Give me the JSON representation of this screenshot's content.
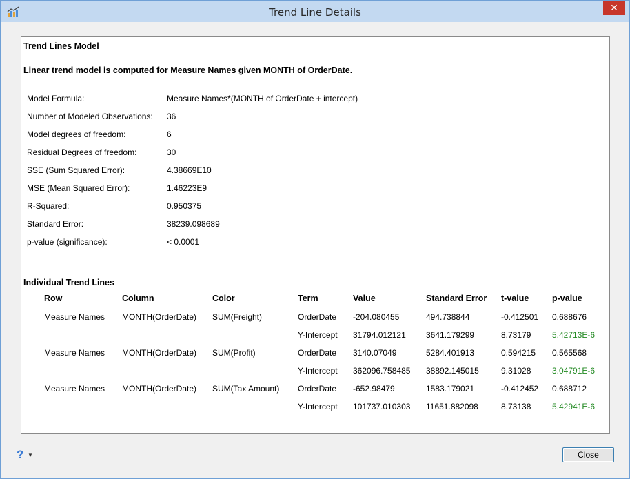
{
  "window": {
    "title": "Trend Line Details",
    "close_glyph": "✕"
  },
  "report": {
    "heading": "Trend Lines Model",
    "description": "Linear trend model is computed for Measure Names given MONTH of OrderDate.",
    "stats": [
      {
        "label": "Model Formula:",
        "value": "Measure Names*(MONTH of OrderDate + intercept)"
      },
      {
        "label": "Number of Modeled Observations:",
        "value": "36"
      },
      {
        "label": "Model degrees of freedom:",
        "value": "6"
      },
      {
        "label": "Residual Degrees of freedom:",
        "value": "30"
      },
      {
        "label": "SSE (Sum Squared Error):",
        "value": "4.38669E10"
      },
      {
        "label": "MSE (Mean Squared Error):",
        "value": "1.46223E9"
      },
      {
        "label": "R-Squared:",
        "value": "0.950375"
      },
      {
        "label": "Standard Error:",
        "value": "38239.098689"
      },
      {
        "label": "p-value (significance):",
        "value": "< 0.0001"
      }
    ],
    "trend_section_title": "Individual Trend Lines",
    "columns": [
      "Row",
      "Column",
      "Color",
      "Term",
      "Value",
      "Standard Error",
      "t-value",
      "p-value"
    ],
    "rows": [
      {
        "row": "Measure Names",
        "column": "MONTH(OrderDate)",
        "color": "SUM(Freight)",
        "terms": [
          {
            "term": "OrderDate",
            "value": "-204.080455",
            "se": "494.738844",
            "t": "-0.412501",
            "p": "0.688676",
            "p_significant": false
          },
          {
            "term": "Y-Intercept",
            "value": "31794.012121",
            "se": "3641.179299",
            "t": "8.73179",
            "p": "5.42713E-6",
            "p_significant": true
          }
        ]
      },
      {
        "row": "Measure Names",
        "column": "MONTH(OrderDate)",
        "color": "SUM(Profit)",
        "terms": [
          {
            "term": "OrderDate",
            "value": "3140.07049",
            "se": "5284.401913",
            "t": "0.594215",
            "p": "0.565568",
            "p_significant": false
          },
          {
            "term": "Y-Intercept",
            "value": "362096.758485",
            "se": "38892.145015",
            "t": "9.31028",
            "p": "3.04791E-6",
            "p_significant": true
          }
        ]
      },
      {
        "row": "Measure Names",
        "column": "MONTH(OrderDate)",
        "color": "SUM(Tax Amount)",
        "terms": [
          {
            "term": "OrderDate",
            "value": "-652.98479",
            "se": "1583.179021",
            "t": "-0.412452",
            "p": "0.688712",
            "p_significant": false
          },
          {
            "term": "Y-Intercept",
            "value": "101737.010303",
            "se": "11651.882098",
            "t": "8.73138",
            "p": "5.42941E-6",
            "p_significant": true
          }
        ]
      }
    ]
  },
  "footer": {
    "help_glyph": "?",
    "help_caret": "▼",
    "close_label": "Close"
  },
  "colors": {
    "significant_p": "#238a23",
    "titlebar": "#c3d9f1",
    "close_x": "#c7362b"
  },
  "icons": {
    "app": "trend-chart-icon",
    "help": "help-question-icon"
  }
}
